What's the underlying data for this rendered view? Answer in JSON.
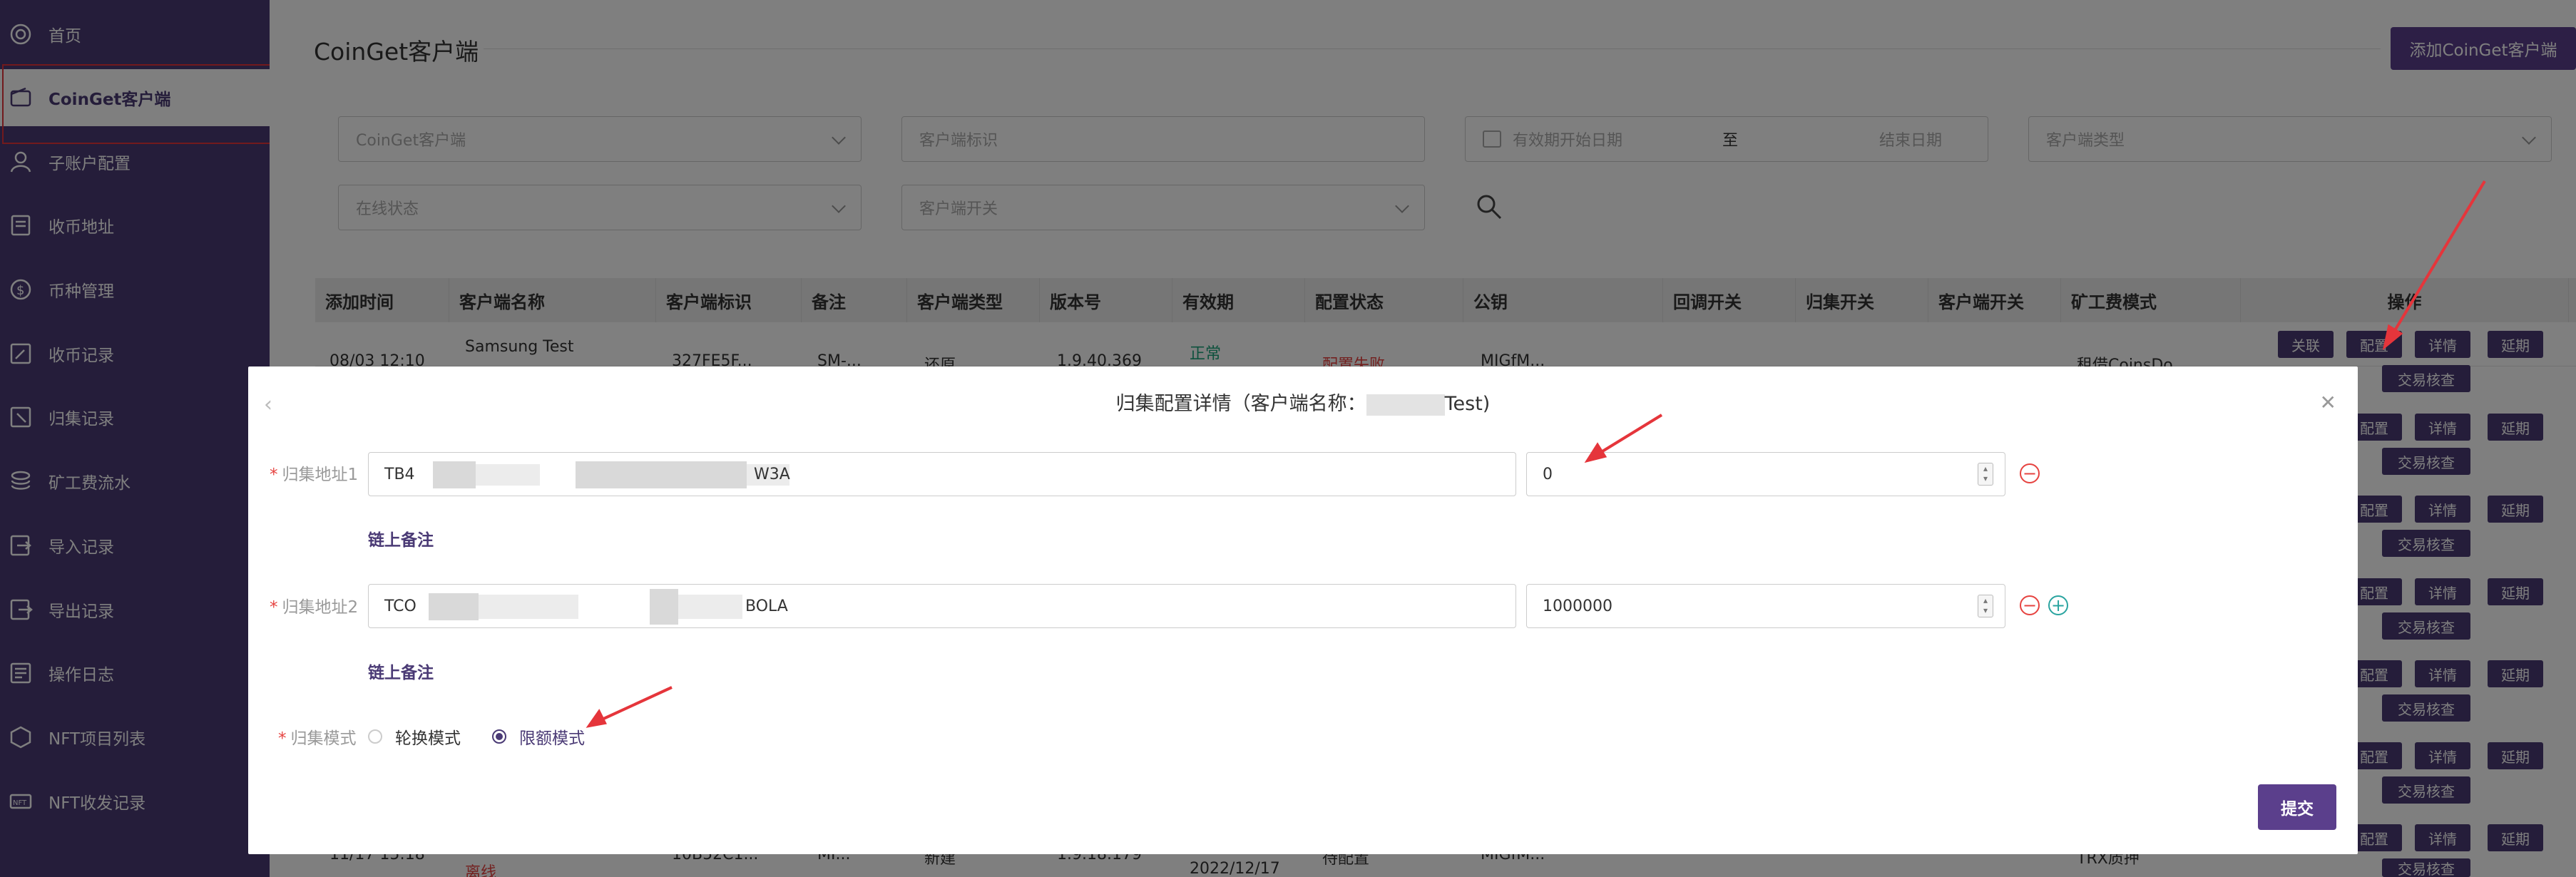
{
  "sidebar": {
    "items": [
      {
        "label": "首页",
        "icon": "dashboard-icon"
      },
      {
        "label": "CoinGet客户端",
        "icon": "wallet-icon",
        "active": true
      },
      {
        "label": "子账户配置",
        "icon": "user-icon"
      },
      {
        "label": "收币地址",
        "icon": "coin-address-icon"
      },
      {
        "label": "币种管理",
        "icon": "dollar-icon"
      },
      {
        "label": "收币记录",
        "icon": "receive-record-icon"
      },
      {
        "label": "归集记录",
        "icon": "collect-record-icon"
      },
      {
        "label": "矿工费流水",
        "icon": "stack-icon"
      },
      {
        "label": "导入记录",
        "icon": "import-icon"
      },
      {
        "label": "导出记录",
        "icon": "export-icon"
      },
      {
        "label": "操作日志",
        "icon": "log-icon"
      },
      {
        "label": "NFT项目列表",
        "icon": "nft-list-icon"
      },
      {
        "label": "NFT收发记录",
        "icon": "nft-record-icon"
      }
    ]
  },
  "page": {
    "title": "CoinGet客户端",
    "add_button": "添加CoinGet客户端"
  },
  "filters": {
    "client": "CoinGet客户端",
    "client_id": "客户端标识",
    "start_date": "有效期开始日期",
    "range_sep": "至",
    "end_date": "结束日期",
    "client_type": "客户端类型",
    "online_status": "在线状态",
    "client_switch": "客户端开关"
  },
  "table": {
    "headers": [
      "添加时间",
      "客户端名称",
      "客户端标识",
      "备注",
      "客户端类型",
      "版本号",
      "有效期",
      "配置状态",
      "公钥",
      "回调开关",
      "归集开关",
      "客户端开关",
      "矿工费模式",
      "操作"
    ],
    "first_row": {
      "time": "08/03 12:10",
      "name": "Samsung Test",
      "id": "327FE5F...",
      "note": "SM-...",
      "type": "还原",
      "version": "1.9.40.369",
      "validity": "正常",
      "config": "配置失败",
      "pubkey": "MIGfM...",
      "fee_mode": "租借CoinsDo..."
    },
    "last_row": {
      "time": "11/17 15:18",
      "status": "离线",
      "id": "10B52C1...",
      "note": "MI...",
      "type": "新建",
      "version": "1.9.18.179",
      "date": "2022/12/17",
      "config": "待配置",
      "pubkey": "MIGfM...",
      "fee_mode": "TRX质押"
    },
    "actions": {
      "link": "关联",
      "config": "配置",
      "detail": "详情",
      "extend": "延期",
      "verify": "交易核查"
    }
  },
  "modal": {
    "title": "归集配置详情（客户端名称：",
    "title_name_visible": "Test)",
    "back_icon": "chevron-left-icon",
    "close_icon": "close-icon",
    "address1_label": "归集地址1",
    "address1_prefix": "TB4",
    "address1_suffix": "W3A",
    "address1_amount": "0",
    "address2_label": "归集地址2",
    "address2_prefix": "TCO",
    "address2_suffix": "BOLA",
    "address2_amount": "1000000",
    "chain_note": "链上备注",
    "mode_label": "归集模式",
    "mode_option1": "轮换模式",
    "mode_option2": "限额模式",
    "submit": "提交"
  },
  "colors": {
    "sidebar": "#4a3a75",
    "primary": "#5b3f8c",
    "annotation": "#e5353b"
  }
}
